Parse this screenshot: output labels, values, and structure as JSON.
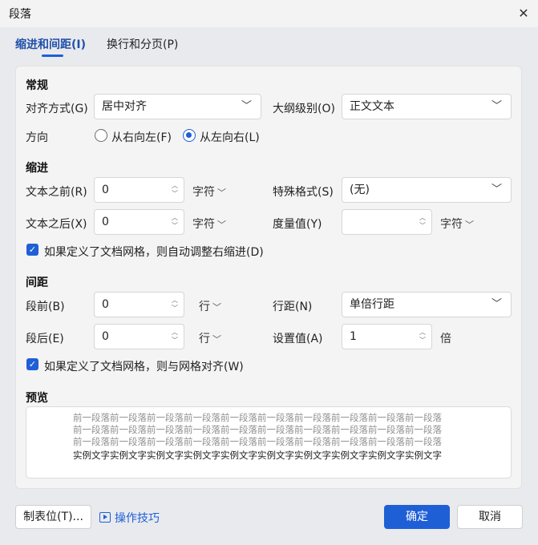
{
  "window": {
    "title": "段落",
    "close_glyph": "✕"
  },
  "tabs": [
    {
      "label": "缩进和间距(I)",
      "active": true
    },
    {
      "label": "换行和分页(P)",
      "active": false
    }
  ],
  "general": {
    "heading": "常规",
    "alignment_label": "对齐方式(G)",
    "alignment_value": "居中对齐",
    "outline_label": "大纲级别(O)",
    "outline_value": "正文文本",
    "direction_label": "方向",
    "rtl_label": "从右向左(F)",
    "ltr_label": "从左向右(L)"
  },
  "indent": {
    "heading": "缩进",
    "before_label": "文本之前(R)",
    "before_value": "0",
    "before_unit": "字符",
    "after_label": "文本之后(X)",
    "after_value": "0",
    "after_unit": "字符",
    "special_label": "特殊格式(S)",
    "special_value": "(无)",
    "measure_label": "度量值(Y)",
    "measure_value": "",
    "measure_unit": "字符",
    "auto_adjust_label": "如果定义了文档网格，则自动调整右缩进(D)"
  },
  "spacing": {
    "heading": "间距",
    "before_label": "段前(B)",
    "before_value": "0",
    "before_unit": "行",
    "after_label": "段后(E)",
    "after_value": "0",
    "after_unit": "行",
    "line_label": "行距(N)",
    "line_value": "单倍行距",
    "setting_label": "设置值(A)",
    "setting_value": "1",
    "setting_unit": "倍",
    "snap_grid_label": "如果定义了文档网格，则与网格对齐(W)"
  },
  "preview": {
    "heading": "预览",
    "prev_lines": [
      "前一段落前一段落前一段落前一段落前一段落前一段落前一段落前一段落前一段落前一段落",
      "前一段落前一段落前一段落前一段落前一段落前一段落前一段落前一段落前一段落前一段落",
      "前一段落前一段落前一段落前一段落前一段落前一段落前一段落前一段落前一段落前一段落"
    ],
    "sample_line": "实例文字实例文字实例文字实例文字实例文字实例文字实例文字实例文字实例文字实例文字"
  },
  "footer": {
    "tabs_button": "制表位(T)...",
    "tips_link": "操作技巧",
    "ok_button": "确定",
    "cancel_button": "取消"
  },
  "icons": {
    "chevron": "chevron-down-icon",
    "check": "checkmark-icon",
    "play": "play-icon",
    "close": "close-icon"
  },
  "colors": {
    "accent": "#1f5fd6",
    "tab_active": "#1f4fa8",
    "panel_bg": "#f4f4f4",
    "window_bg": "#e9eaee"
  }
}
